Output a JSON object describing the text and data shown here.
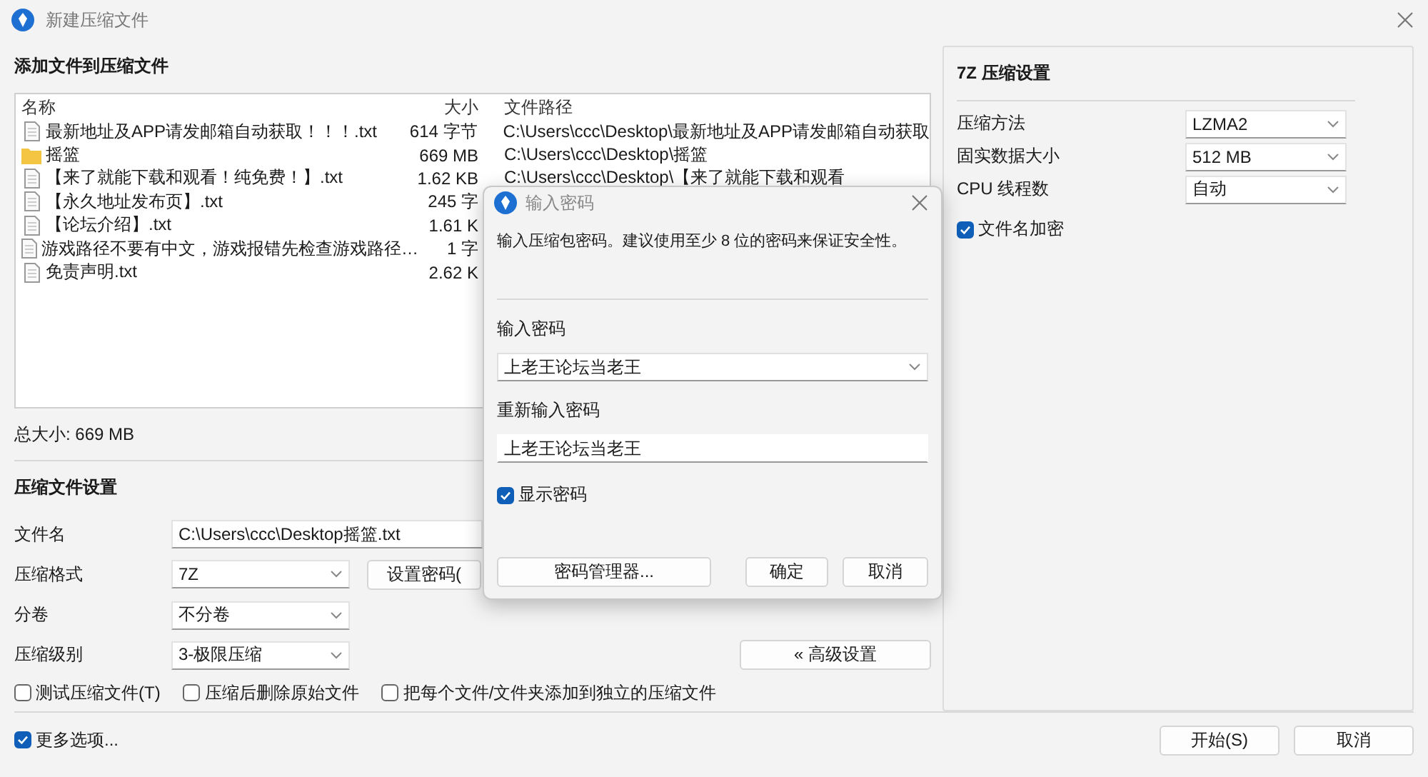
{
  "window": {
    "title": "新建压缩文件"
  },
  "files": {
    "heading": "添加文件到压缩文件",
    "columns": [
      "名称",
      "大小",
      "文件路径"
    ],
    "rows": [
      {
        "kind": "file",
        "name": "最新地址及APP请发邮箱自动获取！！！.txt",
        "size": "614 字节",
        "path": "C:\\Users\\ccc\\Desktop\\最新地址及APP请发邮箱自动获取"
      },
      {
        "kind": "folder",
        "name": "摇篮",
        "size": "669 MB",
        "path": "C:\\Users\\ccc\\Desktop\\摇篮"
      },
      {
        "kind": "file",
        "name": "【来了就能下载和观看！纯免费！】.txt",
        "size": "1.62 KB",
        "path": "C:\\Users\\ccc\\Desktop\\【来了就能下载和观看"
      },
      {
        "kind": "file",
        "name": "【永久地址发布页】.txt",
        "size": "245 字"
      },
      {
        "kind": "file",
        "name": "【论坛介绍】.txt",
        "size": "1.61 K"
      },
      {
        "kind": "file",
        "name": "游戏路径不要有中文，游戏报错先检查游戏路径…",
        "size": "1 字"
      },
      {
        "kind": "file",
        "name": "免责声明.txt",
        "size": "2.62 K"
      }
    ],
    "total": "总大小: 669 MB"
  },
  "archive_settings": {
    "heading": "压缩文件设置",
    "fields": [
      {
        "kind": "text",
        "label": "文件名",
        "value": "C:\\Users\\ccc\\Desktop摇篮.txt"
      },
      {
        "kind": "dropdown",
        "label": "压缩格式",
        "value": "7Z"
      },
      {
        "kind": "dropdown",
        "label": "分卷",
        "value": "不分卷"
      },
      {
        "kind": "dropdown",
        "label": "压缩级别",
        "value": "3-极限压缩"
      }
    ],
    "password_button": "设置密码(",
    "advanced_button": "« 高级设置",
    "options": [
      {
        "label": "测试压缩文件(T)",
        "checked": false
      },
      {
        "label": "压缩后删除原始文件",
        "checked": false
      },
      {
        "label": "把每个文件/文件夹添加到独立的压缩文件",
        "checked": false
      }
    ]
  },
  "method_settings": {
    "heading": "7Z 压缩设置",
    "fields": [
      {
        "label": "压缩方法",
        "value": "LZMA2"
      },
      {
        "label": "固实数据大小",
        "value": "512 MB"
      },
      {
        "label": "CPU 线程数",
        "value": "自动"
      }
    ],
    "options": [
      {
        "label": "文件名加密",
        "checked": true
      }
    ]
  },
  "more_options": {
    "label": "更多选项...",
    "checked": true
  },
  "buttons": [
    "开始(S)",
    "取消"
  ],
  "password_dialog": {
    "title": "输入密码",
    "message": "输入压缩包密码。建议使用至少 8 位的密码来保证安全性。",
    "password_label": "输入密码",
    "password": "上老王论坛当老王",
    "confirm_label": "重新输入密码",
    "confirm": "上老王论坛当老王",
    "show_password": {
      "label": "显示密码",
      "checked": true
    },
    "buttons": [
      "密码管理器...",
      "确定",
      "取消"
    ]
  }
}
